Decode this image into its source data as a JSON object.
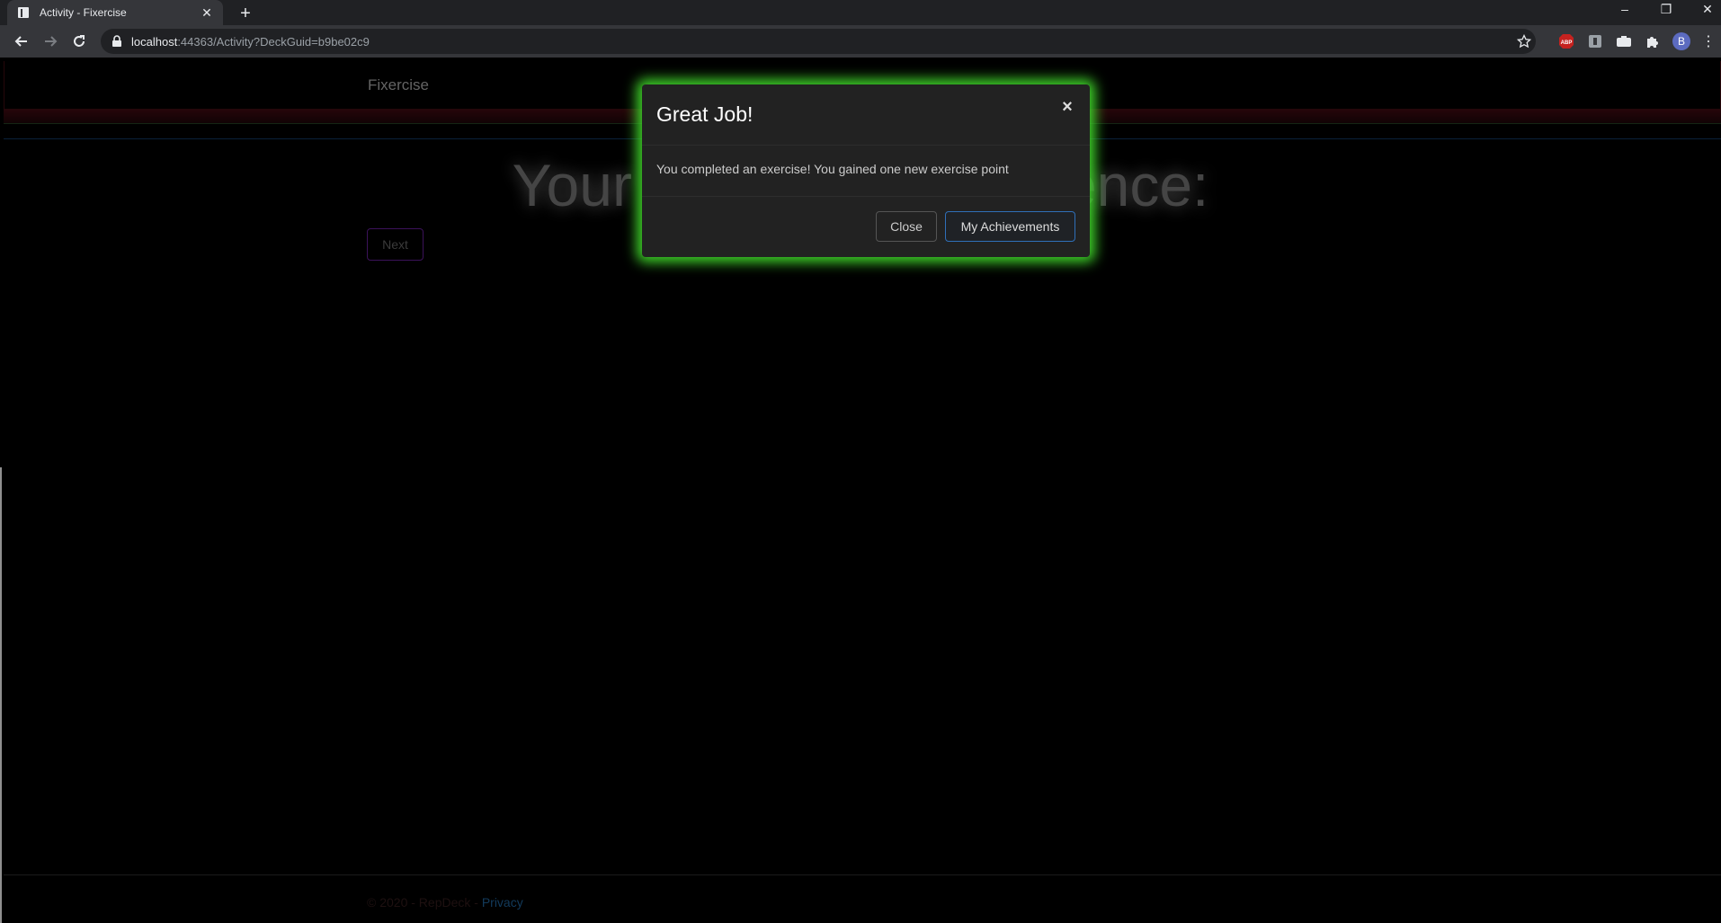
{
  "browser": {
    "tab_title": "Activity - Fixercise",
    "url_host": "localhost",
    "url_path": ":44363/Activity?DeckGuid=b9be02c9",
    "profile_initial": "B",
    "extensions": [
      "adblock-plus-icon",
      "extension-icon",
      "camera-extension-icon",
      "puzzle-icon"
    ]
  },
  "navbar": {
    "brand": "Fixercise"
  },
  "main": {
    "heading_left": "Your",
    "heading_right": "ence:",
    "next_label": "Next"
  },
  "footer": {
    "copyright": "© 2020 - RepDeck - ",
    "privacy_link": "Privacy"
  },
  "modal": {
    "title": "Great Job!",
    "close_symbol": "×",
    "message": "You completed an exercise! You gained one new exercise point",
    "close_label": "Close",
    "achievements_label": "My Achievements",
    "glow_color": "#3fd42a"
  }
}
